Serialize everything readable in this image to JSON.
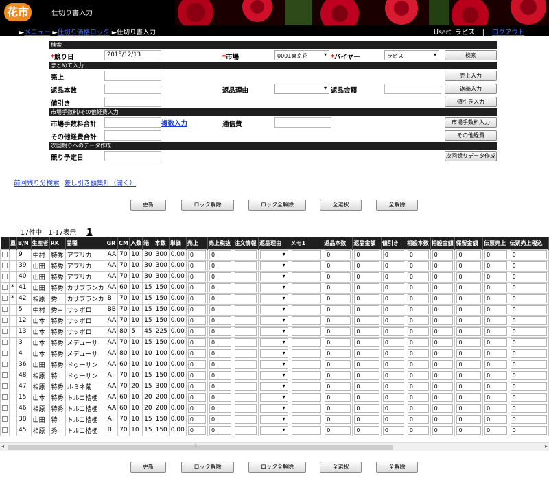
{
  "header": {
    "logo": "花市",
    "title": "仕切り書入力",
    "breadcrumb": [
      "メニュー",
      "仕切り価格ロック",
      "仕切り書入力"
    ],
    "user_label": "User：ラピス",
    "separator": "|",
    "logout": "ログアウト"
  },
  "form": {
    "section_search": "検索",
    "auction_date_label": "競り日",
    "auction_date_value": "2015/12/13",
    "market_label": "市場",
    "market_value": "0001東京花",
    "buyer_label": "バイヤー",
    "buyer_value": "ラピス",
    "search_button": "検索",
    "section_bulk": "まとめて入力",
    "sales_label": "売上",
    "sales_button": "売上入力",
    "return_count_label": "返品本数",
    "return_reason_label": "返品理由",
    "return_amount_label": "返品金額",
    "return_button": "返品入力",
    "discount_label": "値引き",
    "discount_button": "値引き入力",
    "section_fees": "市場手数料/その他経費入力",
    "market_fee_label": "市場手数料合計",
    "multi_input_link": "複数入力",
    "comm_fee_label": "通信費",
    "market_fee_button": "市場手数料入力",
    "other_fee_label": "その他経費合計",
    "other_fee_button": "その他経費",
    "section_next": "次回競りへのデータ作成",
    "next_date_label": "競り予定日",
    "next_button": "次回競りデータ作成"
  },
  "links": {
    "prev_remaining": "前回残り分検索",
    "deduction_total": "差し引き額集計（開く）"
  },
  "actions": {
    "update": "更新",
    "unlock": "ロック解除",
    "unlock_all": "ロック全解除",
    "select_all": "全選択",
    "deselect_all": "全解除"
  },
  "pager": {
    "summary": "17件中　1-17表示",
    "page": "1"
  },
  "grid": {
    "columns": [
      "",
      "重",
      "B/N",
      "生産者",
      "RK",
      "品種",
      "GR",
      "CM",
      "入数",
      "箱",
      "本数",
      "単価",
      "売上",
      "売上税抜",
      "注文情報",
      "返品理由",
      "メモ1",
      "返品本数",
      "返品金額",
      "値引き",
      "相殺本数",
      "相殺金額",
      "保留金額",
      "伝票売上",
      "伝票売上税込"
    ],
    "rows": [
      {
        "mark": "",
        "bn": "9",
        "producer": "中村",
        "rk": "特秀",
        "variety": "アプリカ",
        "gr": "AA",
        "cm": "70",
        "qty": "10",
        "box": "30",
        "count": "300",
        "price": "0.00",
        "sales": "0",
        "net": "0",
        "ret_n": "0",
        "ret_a": "0",
        "disc": "0",
        "off_n": "0",
        "off_a": "0",
        "hold": "0",
        "slip": "0",
        "slip_t": "0"
      },
      {
        "mark": "",
        "bn": "39",
        "producer": "山田",
        "rk": "特秀",
        "variety": "アプリカ",
        "gr": "AA",
        "cm": "70",
        "qty": "10",
        "box": "30",
        "count": "300",
        "price": "0.00",
        "sales": "0",
        "net": "0",
        "ret_n": "0",
        "ret_a": "0",
        "disc": "0",
        "off_n": "0",
        "off_a": "0",
        "hold": "0",
        "slip": "0",
        "slip_t": "0"
      },
      {
        "mark": "",
        "bn": "40",
        "producer": "山田",
        "rk": "特秀",
        "variety": "アプリカ",
        "gr": "AA",
        "cm": "70",
        "qty": "10",
        "box": "30",
        "count": "300",
        "price": "0.00",
        "sales": "0",
        "net": "0",
        "ret_n": "0",
        "ret_a": "0",
        "disc": "0",
        "off_n": "0",
        "off_a": "0",
        "hold": "0",
        "slip": "0",
        "slip_t": "0"
      },
      {
        "mark": "*",
        "bn": "41",
        "producer": "山田",
        "rk": "特秀",
        "variety": "カサブランカ",
        "gr": "AA",
        "cm": "60",
        "qty": "10",
        "box": "15",
        "count": "150",
        "price": "0.00",
        "sales": "0",
        "net": "0",
        "ret_n": "0",
        "ret_a": "0",
        "disc": "0",
        "off_n": "0",
        "off_a": "0",
        "hold": "0",
        "slip": "0",
        "slip_t": "0"
      },
      {
        "mark": "*",
        "bn": "42",
        "producer": "相原",
        "rk": "秀",
        "variety": "カサブランカ",
        "gr": "B",
        "cm": "70",
        "qty": "10",
        "box": "15",
        "count": "150",
        "price": "0.00",
        "sales": "0",
        "net": "0",
        "ret_n": "0",
        "ret_a": "0",
        "disc": "0",
        "off_n": "0",
        "off_a": "0",
        "hold": "0",
        "slip": "0",
        "slip_t": "0"
      },
      {
        "mark": "",
        "bn": "5",
        "producer": "中村",
        "rk": "秀+",
        "variety": "サッポロ",
        "gr": "BB",
        "cm": "70",
        "qty": "10",
        "box": "15",
        "count": "150",
        "price": "0.00",
        "sales": "0",
        "net": "0",
        "ret_n": "0",
        "ret_a": "0",
        "disc": "0",
        "off_n": "0",
        "off_a": "0",
        "hold": "0",
        "slip": "0",
        "slip_t": "0"
      },
      {
        "mark": "",
        "bn": "12",
        "producer": "山本",
        "rk": "特秀",
        "variety": "サッポロ",
        "gr": "AA",
        "cm": "70",
        "qty": "10",
        "box": "15",
        "count": "150",
        "price": "0.00",
        "sales": "0",
        "net": "0",
        "ret_n": "0",
        "ret_a": "0",
        "disc": "0",
        "off_n": "0",
        "off_a": "0",
        "hold": "0",
        "slip": "0",
        "slip_t": "0"
      },
      {
        "mark": "",
        "bn": "13",
        "producer": "山本",
        "rk": "特秀",
        "variety": "サッポロ",
        "gr": "AA",
        "cm": "80",
        "qty": "5",
        "box": "45",
        "count": "225",
        "price": "0.00",
        "sales": "0",
        "net": "0",
        "ret_n": "0",
        "ret_a": "0",
        "disc": "0",
        "off_n": "0",
        "off_a": "0",
        "hold": "0",
        "slip": "0",
        "slip_t": "0"
      },
      {
        "mark": "",
        "bn": "3",
        "producer": "山本",
        "rk": "特秀",
        "variety": "メデューサ",
        "gr": "AA",
        "cm": "70",
        "qty": "10",
        "box": "15",
        "count": "150",
        "price": "0.00",
        "sales": "0",
        "net": "0",
        "ret_n": "0",
        "ret_a": "0",
        "disc": "0",
        "off_n": "0",
        "off_a": "0",
        "hold": "0",
        "slip": "0",
        "slip_t": "0"
      },
      {
        "mark": "",
        "bn": "4",
        "producer": "山本",
        "rk": "特秀",
        "variety": "メデューサ",
        "gr": "AA",
        "cm": "80",
        "qty": "10",
        "box": "10",
        "count": "100",
        "price": "0.00",
        "sales": "0",
        "net": "0",
        "ret_n": "0",
        "ret_a": "0",
        "disc": "0",
        "off_n": "0",
        "off_a": "0",
        "hold": "0",
        "slip": "0",
        "slip_t": "0"
      },
      {
        "mark": "",
        "bn": "36",
        "producer": "山田",
        "rk": "特秀",
        "variety": "ドゥーサン",
        "gr": "AA",
        "cm": "60",
        "qty": "10",
        "box": "10",
        "count": "100",
        "price": "0.00",
        "sales": "0",
        "net": "0",
        "ret_n": "0",
        "ret_a": "0",
        "disc": "0",
        "off_n": "0",
        "off_a": "0",
        "hold": "0",
        "slip": "0",
        "slip_t": "0"
      },
      {
        "mark": "",
        "bn": "48",
        "producer": "相原",
        "rk": "特",
        "variety": "ドゥーサン",
        "gr": "A",
        "cm": "70",
        "qty": "10",
        "box": "15",
        "count": "150",
        "price": "0.00",
        "sales": "0",
        "net": "0",
        "ret_n": "0",
        "ret_a": "0",
        "disc": "0",
        "off_n": "0",
        "off_a": "0",
        "hold": "0",
        "slip": "0",
        "slip_t": "0"
      },
      {
        "mark": "",
        "bn": "47",
        "producer": "相原",
        "rk": "特秀",
        "variety": "ルミネ菊",
        "gr": "AA",
        "cm": "70",
        "qty": "20",
        "box": "15",
        "count": "300",
        "price": "0.00",
        "sales": "0",
        "net": "0",
        "ret_n": "0",
        "ret_a": "0",
        "disc": "0",
        "off_n": "0",
        "off_a": "0",
        "hold": "0",
        "slip": "0",
        "slip_t": "0"
      },
      {
        "mark": "",
        "bn": "15",
        "producer": "山本",
        "rk": "特秀",
        "variety": "トルコ桔梗",
        "gr": "AA",
        "cm": "60",
        "qty": "10",
        "box": "20",
        "count": "200",
        "price": "0.00",
        "sales": "0",
        "net": "0",
        "ret_n": "0",
        "ret_a": "0",
        "disc": "0",
        "off_n": "0",
        "off_a": "0",
        "hold": "0",
        "slip": "0",
        "slip_t": "0"
      },
      {
        "mark": "",
        "bn": "46",
        "producer": "相原",
        "rk": "特秀",
        "variety": "トルコ桔梗",
        "gr": "AA",
        "cm": "60",
        "qty": "10",
        "box": "20",
        "count": "200",
        "price": "0.00",
        "sales": "0",
        "net": "0",
        "ret_n": "0",
        "ret_a": "0",
        "disc": "0",
        "off_n": "0",
        "off_a": "0",
        "hold": "0",
        "slip": "0",
        "slip_t": "0"
      },
      {
        "mark": "",
        "bn": "38",
        "producer": "山田",
        "rk": "特",
        "variety": "トルコ桔梗",
        "gr": "A",
        "cm": "70",
        "qty": "10",
        "box": "15",
        "count": "150",
        "price": "0.00",
        "sales": "0",
        "net": "0",
        "ret_n": "0",
        "ret_a": "0",
        "disc": "0",
        "off_n": "0",
        "off_a": "0",
        "hold": "0",
        "slip": "0",
        "slip_t": "0"
      },
      {
        "mark": "",
        "bn": "45",
        "producer": "相原",
        "rk": "秀",
        "variety": "トルコ桔梗",
        "gr": "B",
        "cm": "70",
        "qty": "10",
        "box": "15",
        "count": "150",
        "price": "0.00",
        "sales": "0",
        "net": "0",
        "ret_n": "0",
        "ret_a": "0",
        "disc": "0",
        "off_n": "0",
        "off_a": "0",
        "hold": "0",
        "slip": "0",
        "slip_t": "0"
      }
    ]
  },
  "scrollbar": {
    "left_arrow": "◂",
    "right_arrow": "▸",
    "grip": "⦙⦙⦙"
  },
  "colors": {
    "header_bg": "#000000",
    "logo_orange": "#f08a1c",
    "rose_red": "#c8001a",
    "bar_dark": "#1f1f1f",
    "link_blue": "#1a3bd6",
    "required_red": "#dd0000"
  }
}
